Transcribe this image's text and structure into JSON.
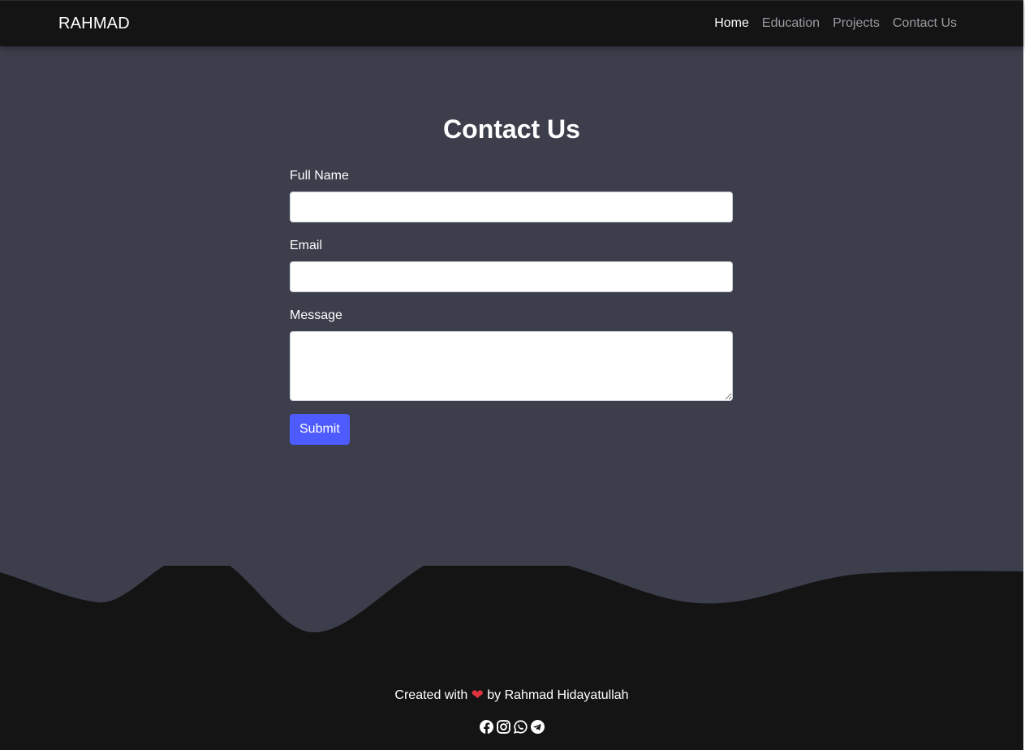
{
  "navbar": {
    "brand": "RAHMAD",
    "links": [
      {
        "label": "Home",
        "active": true
      },
      {
        "label": "Education",
        "active": false
      },
      {
        "label": "Projects",
        "active": false
      },
      {
        "label": "Contact Us",
        "active": false
      }
    ]
  },
  "contact": {
    "title": "Contact Us",
    "full_name": {
      "label": "Full Name",
      "value": "",
      "placeholder": ""
    },
    "email": {
      "label": "Email",
      "value": "",
      "placeholder": ""
    },
    "message": {
      "label": "Message",
      "value": "",
      "placeholder": ""
    },
    "submit_label": "Submit"
  },
  "footer": {
    "created_prefix": "Created with",
    "created_suffix": "by Rahmad Hidayatullah",
    "heart_icon": "heart-icon",
    "social_icons": [
      "facebook-icon",
      "instagram-icon",
      "whatsapp-icon",
      "telegram-icon"
    ]
  },
  "colors": {
    "navbar_bg": "#141415",
    "main_bg": "#3c3e4b",
    "footer_bg": "#141415",
    "accent": "#4e5bff",
    "heart": "#e0323e"
  }
}
